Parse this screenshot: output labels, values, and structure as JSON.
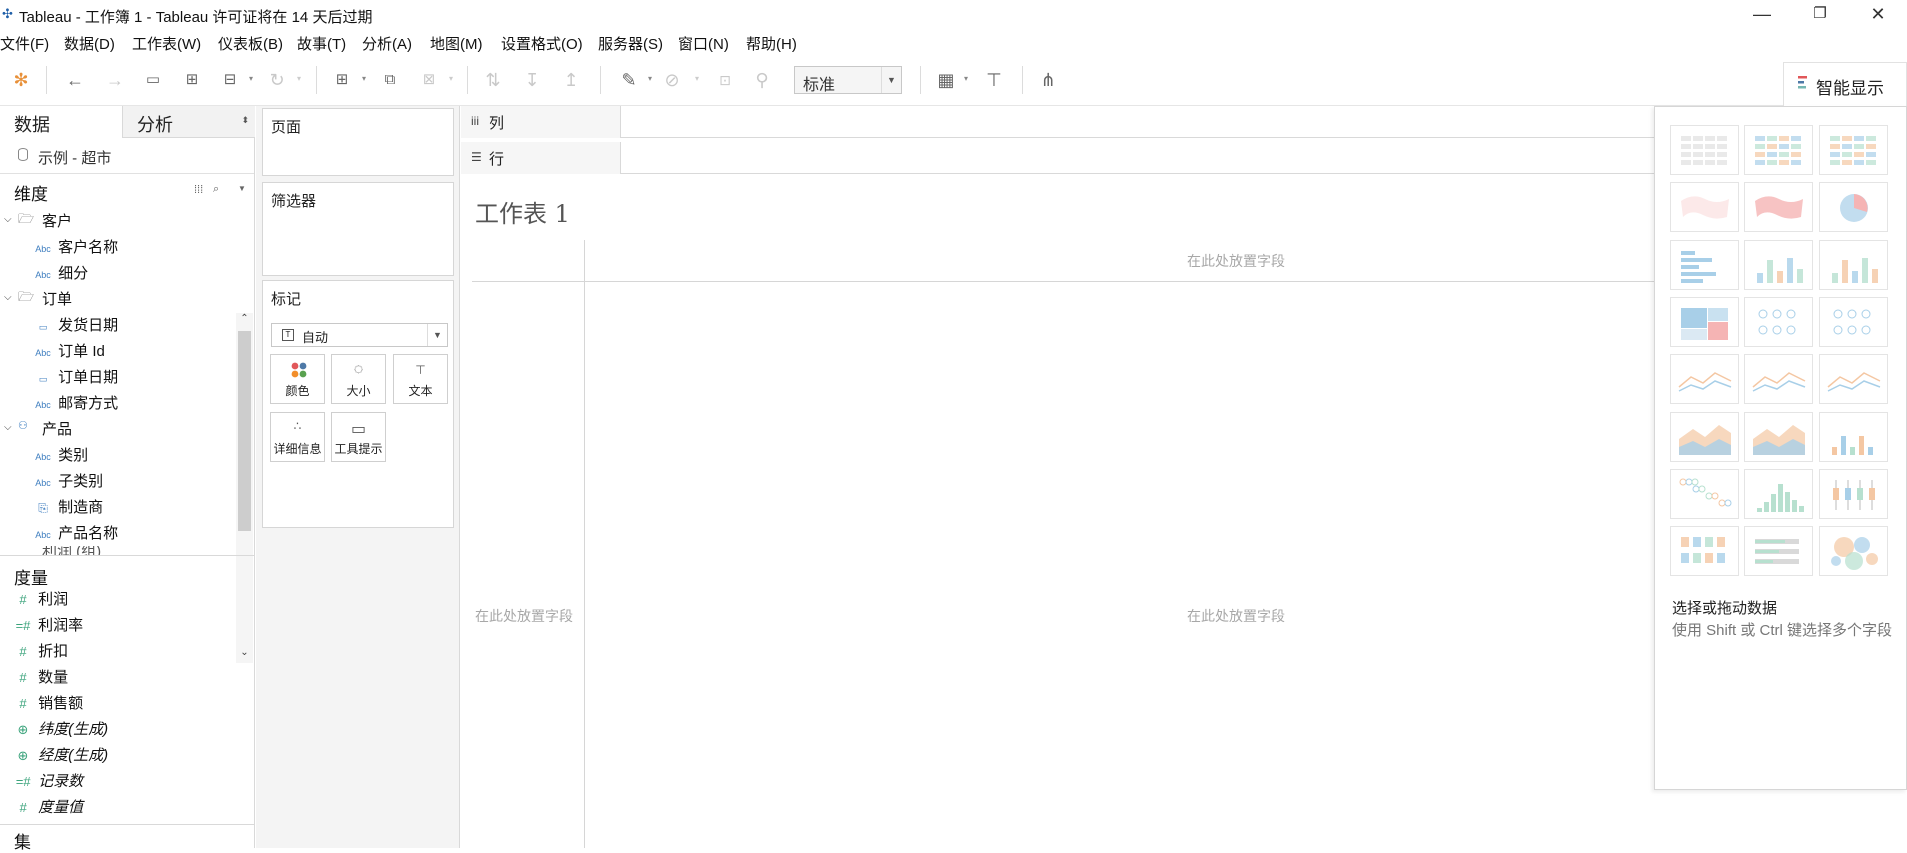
{
  "window": {
    "title": "Tableau - 工作簿 1 - Tableau 许可证将在 14 天后过期",
    "minimize": "—",
    "maximize": "❐",
    "close": "✕"
  },
  "menu": [
    "文件(F)",
    "数据(D)",
    "工作表(W)",
    "仪表板(B)",
    "故事(T)",
    "分析(A)",
    "地图(M)",
    "设置格式(O)",
    "服务器(S)",
    "窗口(N)",
    "帮助(H)"
  ],
  "toolbar": {
    "fit_value": "标准",
    "show_me_label": "智能显示"
  },
  "data_pane": {
    "tab_data": "数据",
    "tab_analysis": "分析",
    "data_source": "示例 - 超市",
    "dimensions_header": "维度",
    "dimensions": [
      {
        "label": "客户",
        "type": "folder"
      },
      {
        "label": "客户名称",
        "type": "abc"
      },
      {
        "label": "细分",
        "type": "abc"
      },
      {
        "label": "订单",
        "type": "folder"
      },
      {
        "label": "发货日期",
        "type": "date"
      },
      {
        "label": "订单 Id",
        "type": "abc"
      },
      {
        "label": "订单日期",
        "type": "date"
      },
      {
        "label": "邮寄方式",
        "type": "abc"
      },
      {
        "label": "产品",
        "type": "hierarchy"
      },
      {
        "label": "类别",
        "type": "abc"
      },
      {
        "label": "子类别",
        "type": "abc"
      },
      {
        "label": "制造商",
        "type": "link"
      },
      {
        "label": "产品名称",
        "type": "abc"
      },
      {
        "label": "利润 (组)",
        "type": "partial"
      }
    ],
    "measures_header": "度量",
    "measures": [
      {
        "label": "利润",
        "italic": false
      },
      {
        "label": "利润率",
        "italic": false
      },
      {
        "label": "折扣",
        "italic": false
      },
      {
        "label": "数量",
        "italic": false
      },
      {
        "label": "销售额",
        "italic": false
      },
      {
        "label": "纬度(生成)",
        "italic": true
      },
      {
        "label": "经度(生成)",
        "italic": true
      },
      {
        "label": "记录数",
        "italic": true
      },
      {
        "label": "度量值",
        "italic": true
      }
    ],
    "sets_header": "集"
  },
  "cards": {
    "pages": "页面",
    "filters": "筛选器",
    "marks": "标记",
    "mark_type": "自动",
    "mark_buttons": [
      "颜色",
      "大小",
      "文本",
      "详细信息",
      "工具提示"
    ]
  },
  "shelves": {
    "columns": "列",
    "rows": "行"
  },
  "view": {
    "sheet_title": "工作表 1",
    "drop_top": "在此处放置字段",
    "drop_left": "在此处放置字段",
    "drop_center": "在此处放置字段"
  },
  "show_me": {
    "hint_title": "选择或拖动数据",
    "hint_body": "使用 Shift 或 Ctrl 键选择多个字段"
  },
  "colors": {
    "accent_red": "#e15759",
    "field_blue": "#3d7dbf",
    "measure_green": "#3aa37b"
  }
}
